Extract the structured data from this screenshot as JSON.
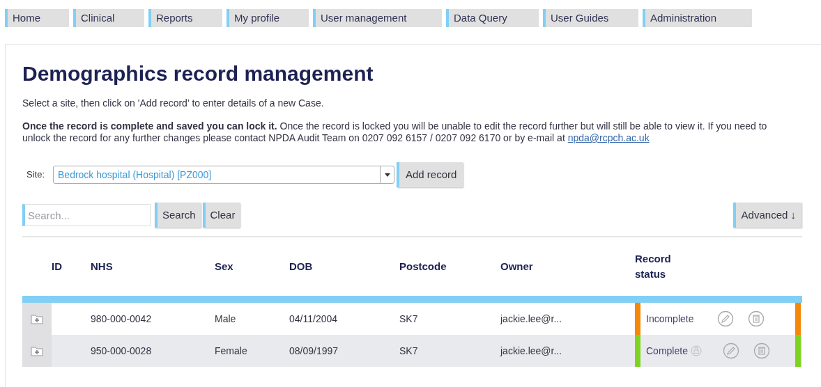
{
  "nav": [
    {
      "label": "Home"
    },
    {
      "label": "Clinical"
    },
    {
      "label": "Reports"
    },
    {
      "label": "My profile"
    },
    {
      "label": "User management"
    },
    {
      "label": "Data Query"
    },
    {
      "label": "User Guides"
    },
    {
      "label": "Administration"
    }
  ],
  "title": "Demographics record management",
  "intro": "Select a site, then click on 'Add record' to enter details of a new Case.",
  "notice": "**Once the record is complete and saved you can lock it.** Once the record is locked you will be unable to edit the record further but will still be able to view it. If you need to unlock the record for any further changes please contact NPDA Audit Team on 0207 092 6157 / 0207 092 6170 or by e-mail at",
  "email": "npda@rcpch.ac.uk",
  "site": {
    "label": "Site:",
    "value": "Bedrock hospital (Hospital) [PZ000]"
  },
  "add_button": "Add record",
  "search": {
    "placeholder": "Search...",
    "button": "Search",
    "clear": "Clear"
  },
  "advanced": "Advanced ↓",
  "table": {
    "columns": [
      "ID",
      "NHS",
      "Sex",
      "DOB",
      "Postcode",
      "Owner",
      "Record status"
    ],
    "rows": [
      {
        "id": "",
        "nhs": "980-000-0042",
        "sex": "Male",
        "dob": "04/11/2004",
        "postcode": "SK7",
        "owner": "jackie.lee@r...",
        "status": "Incomplete",
        "color": "#f5870a",
        "locked": false
      },
      {
        "id": "",
        "nhs": "950-000-0028",
        "sex": "Female",
        "dob": "08/09/1997",
        "postcode": "SK7",
        "owner": "jackie.lee@r...",
        "status": "Complete",
        "color": "#7ed321",
        "locked": true
      }
    ]
  }
}
